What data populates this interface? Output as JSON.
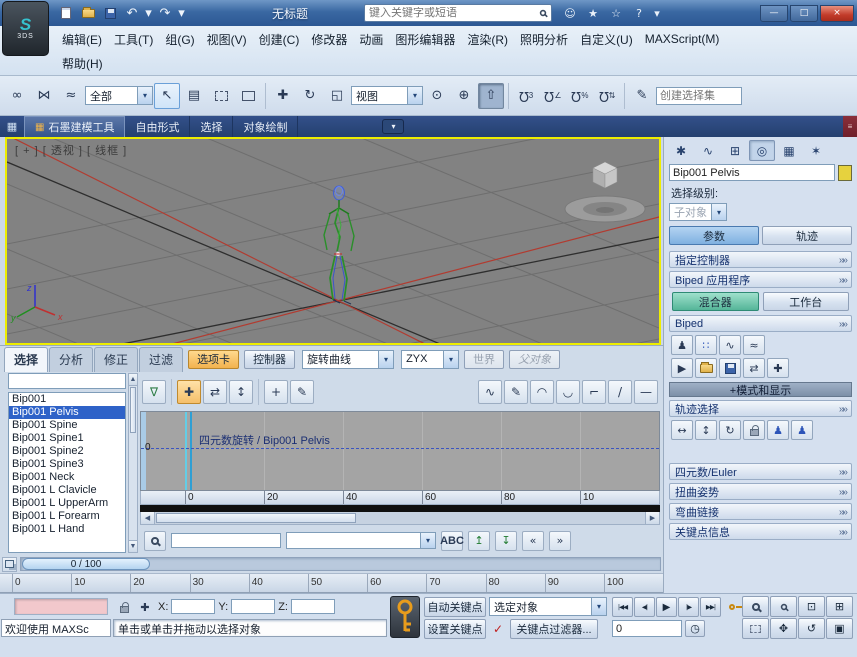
{
  "titlebar": {
    "app_logo": "3DS",
    "app_swirl": "S",
    "title": "无标题",
    "search_placeholder": "键入关键字或短语"
  },
  "menubar": {
    "row1": [
      "编辑(E)",
      "工具(T)",
      "组(G)",
      "视图(V)",
      "创建(C)",
      "修改器",
      "动画",
      "图形编辑器",
      "渲染(R)",
      "照明分析",
      "自定义(U)",
      "MAXScript(M)"
    ],
    "help": "帮助(H)"
  },
  "toolbar": {
    "filter_value": "全部",
    "coord_value": "视图",
    "snap_3d": "3",
    "named_sets_placeholder": "创建选择集"
  },
  "ribbon": {
    "tabs": [
      "石墨建模工具",
      "自由形式",
      "选择",
      "对象绘制"
    ]
  },
  "viewport": {
    "label": "[ + ] [ 透视 ] [ 线框 ]",
    "axis_x": "x",
    "axis_y": "y",
    "axis_z": "z"
  },
  "command_panel": {
    "object_name": "Bip001 Pelvis",
    "selection_level": "选择级别:",
    "sub_object": "子对象",
    "tab_parameters": "参数",
    "tab_trajectories": "轨迹",
    "rollout_assign_controller": "指定控制器",
    "rollout_biped_apps": "Biped 应用程序",
    "btn_mixer": "混合器",
    "btn_workbench": "工作台",
    "rollout_biped": "Biped",
    "modes_display_bar": "+模式和显示",
    "rollout_track_selection": "轨迹选择",
    "rollout_quaternion_euler": "四元数/Euler",
    "rollout_twist_poses": "扭曲姿势",
    "rollout_bend_links": "弯曲链接",
    "rollout_key_info": "关键点信息"
  },
  "motion_panel": {
    "tabs": [
      "选择",
      "分析",
      "修正",
      "过滤"
    ],
    "btn_tab": "选项卡",
    "btn_controller": "控制器",
    "curve_type_value": "旋转曲线",
    "axis_order_value": "ZYX",
    "btn_world": "世界",
    "btn_parent": "父对象",
    "list": [
      "Bip001",
      "Bip001 Pelvis",
      "Bip001 Spine",
      "Bip001 Spine1",
      "Bip001 Spine2",
      "Bip001 Spine3",
      "Bip001 Neck",
      "Bip001 L Clavicle",
      "Bip001 L UpperArm",
      "Bip001 L Forearm",
      "Bip001 L Hand"
    ],
    "track_label": "四元数旋转 / Bip001 Pelvis",
    "value_axis_zero": "0",
    "ruler": [
      "0",
      "20",
      "40",
      "60",
      "80",
      "10"
    ],
    "abc_icon_text": "ABC"
  },
  "timeline": {
    "slider_label": "0 / 100",
    "ticks": [
      "0",
      "10",
      "20",
      "30",
      "40",
      "50",
      "60",
      "70",
      "80",
      "90",
      "100"
    ]
  },
  "statusbar": {
    "listener_text": "欢迎使用 MAXSc",
    "prompt_text": "单击或单击并拖动以选择对象",
    "label_x": "X:",
    "label_y": "Y:",
    "label_z": "Z:",
    "btn_auto_key": "自动关键点",
    "btn_set_key": "设置关键点",
    "selected_filter_value": "选定对象",
    "btn_key_filters": "关键点过滤器...",
    "frame_value": "0"
  }
}
